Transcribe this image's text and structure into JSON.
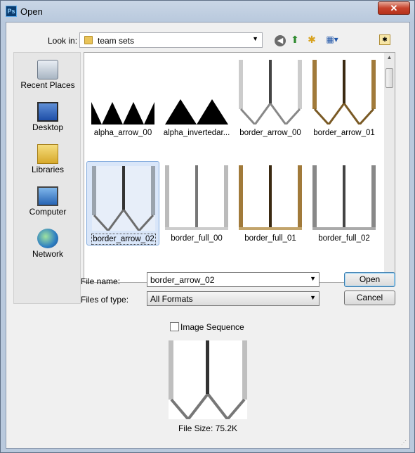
{
  "window": {
    "title": "Open",
    "app_icon": "Ps",
    "close_label": "✕"
  },
  "toolbar": {
    "look_in_label": "Look in:",
    "look_in_value": "team sets",
    "icons": [
      "back-icon",
      "up-folder-icon",
      "new-folder-icon",
      "views-menu-icon"
    ]
  },
  "places": [
    {
      "label": "Recent Places",
      "icon": "recent-places-icon"
    },
    {
      "label": "Desktop",
      "icon": "desktop-icon"
    },
    {
      "label": "Libraries",
      "icon": "libraries-icon"
    },
    {
      "label": "Computer",
      "icon": "computer-icon"
    },
    {
      "label": "Network",
      "icon": "network-icon"
    }
  ],
  "files": [
    {
      "name": "alpha_arrow_00",
      "kind": "alpha-arrow",
      "selected": false
    },
    {
      "name": "alpha_invertedar...",
      "kind": "alpha-inverted",
      "selected": false
    },
    {
      "name": "border_arrow_00",
      "kind": "arrow-gray",
      "selected": false
    },
    {
      "name": "border_arrow_01",
      "kind": "arrow-brown",
      "selected": false
    },
    {
      "name": "border_arrow_02",
      "kind": "arrow-gray",
      "selected": true
    },
    {
      "name": "border_full_00",
      "kind": "full-gray",
      "selected": false
    },
    {
      "name": "border_full_01",
      "kind": "full-brown",
      "selected": false
    },
    {
      "name": "border_full_02",
      "kind": "full-dark",
      "selected": false
    }
  ],
  "form": {
    "file_name_label": "File name:",
    "file_name_value": "border_arrow_02",
    "files_of_type_label": "Files of type:",
    "files_of_type_value": "All Formats",
    "open_label": "Open",
    "cancel_label": "Cancel"
  },
  "preview": {
    "image_sequence_label": "Image Sequence",
    "image_sequence_checked": false,
    "file_size_text": "File Size: 75.2K"
  },
  "colors": {
    "selection": "#d9e6f9",
    "selection_border": "#84acdd",
    "accent": "#3c7fb1"
  }
}
